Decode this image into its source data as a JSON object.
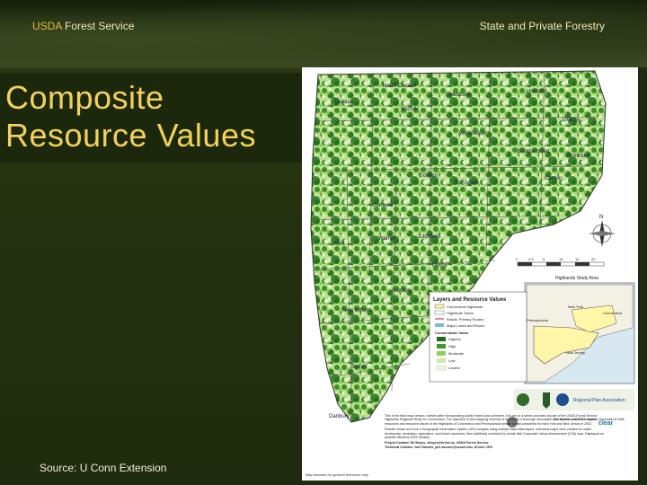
{
  "header": {
    "agency_prefix": "USDA",
    "agency_rest": "Forest Service",
    "right_label": "State and Private Forestry"
  },
  "slide": {
    "title": "Composite Resource Values",
    "source": "Source: U Conn Extension"
  },
  "map": {
    "town_labels": [
      "North Canaan",
      "Colebrook",
      "Hartland",
      "Granby",
      "Norfolk",
      "Canaan",
      "Winchester",
      "Barkhamsted",
      "Simsbury",
      "Goshen",
      "Torrington",
      "Canton",
      "Cornwall",
      "Kent",
      "Warren",
      "Litchfield",
      "Morris",
      "Roxbury",
      "New Milford",
      "Bethel",
      "Danbury",
      "Ridgefield",
      "Sherman",
      "Newtown",
      "Southbury",
      "Woodbury",
      "Bethlehem",
      "Washington"
    ],
    "inset_title": "Highlands Study Area",
    "inset_labels": [
      "Connecticut",
      "New York",
      "Pennsylvania",
      "New Jersey"
    ],
    "legend_title": "Layers and Resource Values",
    "legend_layers": [
      "Connecticut Highlands",
      "Highlands Towns",
      "Roads: Primary Routes",
      "Major Lakes and Rivers"
    ],
    "legend_value_title": "Conservation Value",
    "legend_values": [
      "Highest",
      "High",
      "Moderate",
      "Low",
      "Lowest"
    ],
    "legend_colors": [
      "#1f6b1a",
      "#3f9a2a",
      "#8fcf5a",
      "#cfe9a8",
      "#f1f4e6"
    ],
    "footer_note": "Map features for general reference only",
    "description_paragraph": "This is the final map version, revised after incorporating public review and comment. It is one of a series provided as part of the USDA Forest Service Highlands Regional Study for Connecticut. The objective of this mapping exercise is to provide a thorough description and assessment of the natural resources and resource values in the Highlands of Connecticut and Pennsylvania similar to that completed for New York and New Jersey in 2002.",
    "description_paragraph_2": "Results shown are from a Geographic Information System (GIS) analysis using multiple base data layers. Individual maps were created for water, biodiversity, recreation, agriculture, and forest resources, then additively combined to create this Composite Values Assessment (CVA) map. Displayed as quantile divisions (20% breaks).",
    "project_contact": "Project Contact:  Ed Boyes, eboyes@fs.fed.us, USDA Forest Service",
    "technical_contact": "Technical Contact:  Joel Stocker, joel.stocker@uconn.edu, UConn CES",
    "file_info": "File Number: cvi0903  Compiled: December 8 2006",
    "logo_text": [
      "Regional Plan Association",
      "clear",
      "UConn"
    ],
    "scale_numbers": [
      "0",
      "2.5",
      "5",
      "10",
      "15",
      "20"
    ],
    "compass": "N"
  },
  "colors": {
    "title": "#f3d25a",
    "usda": "#e8b83a",
    "header_text": "#f1e7b5"
  }
}
